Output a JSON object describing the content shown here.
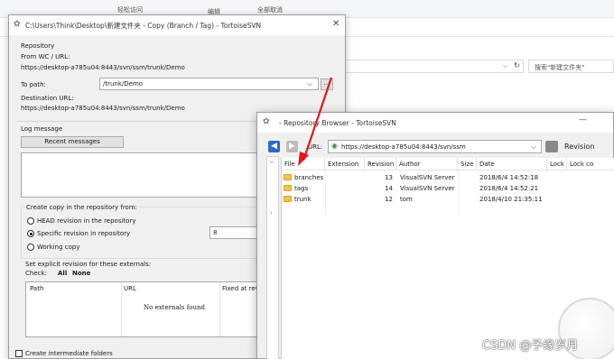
{
  "explorer": {
    "toolbar_frag1": "轻松访问",
    "toolbar_frag2": "编辑",
    "toolbar_frag3": "全部取消",
    "search_placeholder": "搜索\"新建文件夹\""
  },
  "copy_dialog": {
    "title": "C:\\Users\\Think\\Desktop\\新建文件夹 - Copy (Branch / Tag) - TortoiseSVN",
    "repository_label": "Repository",
    "from_label": "From WC / URL:",
    "from_url": "https://desktop-a785u04:8443/svn/ssm/trunk/Demo",
    "to_path_label": "To path:",
    "to_path_value": "/trunk/Demo",
    "browse_label": "...",
    "destination_label": "Destination URL:",
    "destination_url": "https://desktop-a785u04:8443/svn/ssm/trunk/Demo",
    "log_label": "Log message",
    "recent_messages": "Recent messages",
    "create_copy_label": "Create copy in the repository from:",
    "radio_head": "HEAD revision in the repository",
    "radio_specific": "Specific revision in repository",
    "radio_working": "Working copy",
    "revision_value": "8",
    "externals_label": "Set explicit revision for these externals:",
    "check_label": "Check:",
    "check_all": "All",
    "check_none": "None",
    "ext_columns": [
      "Path",
      "URL",
      "Fixed at rev"
    ],
    "no_externals": "No externals found",
    "intermediate_label": "Create intermediate folders"
  },
  "repo_browser": {
    "title": "- Repository Browser - TortoiseSVN",
    "url_label": "URL:",
    "url_value": "https://desktop-a785u04:8443/svn/ssm",
    "revision_label": "Revision",
    "columns": [
      "File",
      "Extension",
      "Revision",
      "Author",
      "Size",
      "Date",
      "Lock",
      "Lock co"
    ],
    "rows": [
      {
        "name": "branches",
        "revision": "13",
        "author": "VisualSVN Server",
        "date": "2018/6/4 14:52:18"
      },
      {
        "name": "tags",
        "revision": "14",
        "author": "VisualSVN Server",
        "date": "2018/6/4 14:52:21"
      },
      {
        "name": "trunk",
        "revision": "12",
        "author": "tom",
        "date": "2018/4/10 21:35:11"
      }
    ]
  },
  "watermark": "CSDN @予缘岁月",
  "colors": {
    "arrow": "#e0161b",
    "folder": "#f3c34d",
    "nav_arrow": "#2b6cc4"
  }
}
